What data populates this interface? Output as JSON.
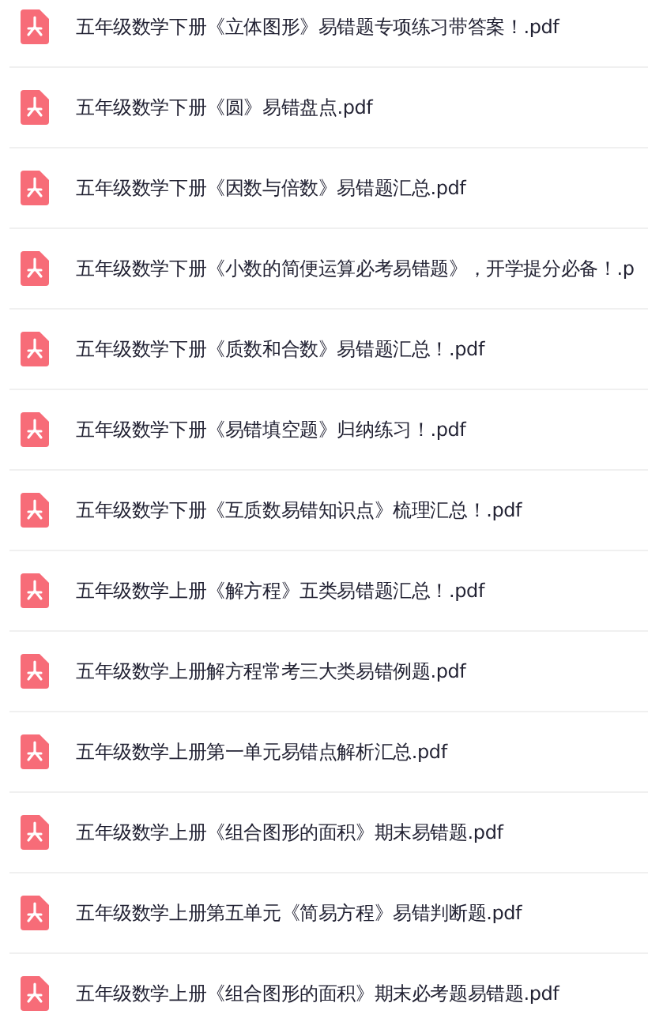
{
  "files": [
    {
      "name": "五年级数学下册《立体图形》易错题专项练习带答案！.pdf"
    },
    {
      "name": "五年级数学下册《圆》易错盘点.pdf"
    },
    {
      "name": "五年级数学下册《因数与倍数》易错题汇总.pdf"
    },
    {
      "name": "五年级数学下册《小数的简便运算必考易错题》，开学提分必备！.p"
    },
    {
      "name": "五年级数学下册《质数和合数》易错题汇总！.pdf"
    },
    {
      "name": "五年级数学下册《易错填空题》归纳练习！.pdf"
    },
    {
      "name": "五年级数学下册《互质数易错知识点》梳理汇总！.pdf"
    },
    {
      "name": "五年级数学上册《解方程》五类易错题汇总！.pdf"
    },
    {
      "name": "五年级数学上册解方程常考三大类易错例题.pdf"
    },
    {
      "name": "五年级数学上册第一单元易错点解析汇总.pdf"
    },
    {
      "name": "五年级数学上册《组合图形的面积》期末易错题.pdf"
    },
    {
      "name": "五年级数学上册第五单元《简易方程》易错判断题.pdf"
    },
    {
      "name": "五年级数学上册《组合图形的面积》期末必考题易错题.pdf"
    }
  ]
}
